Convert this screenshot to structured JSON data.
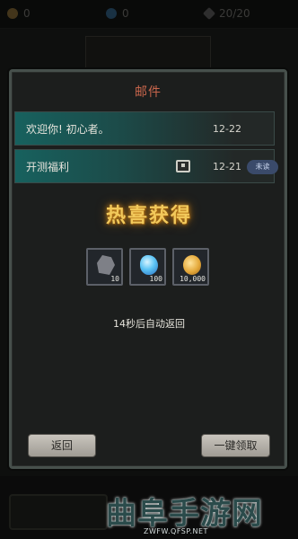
{
  "resources": {
    "gold": "0",
    "gems": "0",
    "stamina": "20/20"
  },
  "mail": {
    "title": "邮件",
    "items": [
      {
        "title": "欢迎你! 初心者。",
        "date": "12-22",
        "badge": ""
      },
      {
        "title": "开测福利",
        "date": "12-21",
        "badge": "未读"
      }
    ]
  },
  "reward": {
    "heading": "热喜获得",
    "items": [
      {
        "icon": "ore-icon",
        "qty": "10"
      },
      {
        "icon": "crystal-icon",
        "qty": "100"
      },
      {
        "icon": "coin-icon",
        "qty": "10,000"
      }
    ],
    "countdown": "14秒后自动返回"
  },
  "buttons": {
    "back": "返回",
    "claim_all": "一键领取"
  },
  "watermark": {
    "text": "曲阜手游网",
    "url": "ZWFW.QFSP.NET"
  }
}
